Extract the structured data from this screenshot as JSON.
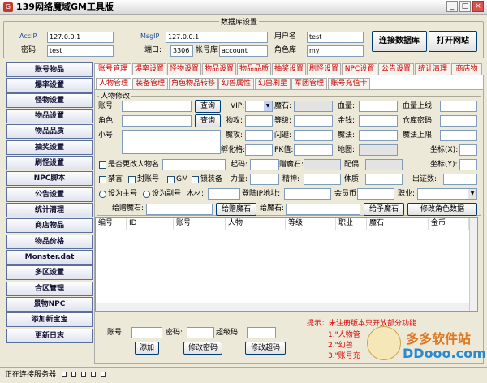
{
  "app": {
    "title": "139网络魔域GM工具版"
  },
  "db": {
    "group_title": "数据库设置",
    "acc_ip_label": "AccIP",
    "acc_ip": "127.0.0.1",
    "msg_ip_label": "MsgIP",
    "msg_ip": "127.0.0.1",
    "user_label": "用户名",
    "user": "test",
    "pass_label": "密码",
    "pass": "test",
    "port_label": "端口:",
    "port": "3306",
    "acc_db_label": "帐号库",
    "acc_db": "account",
    "role_db_label": "角色库",
    "role_db": "my",
    "connect_btn": "连接数据库",
    "open_site_btn": "打开网站"
  },
  "sidebar": {
    "items": [
      {
        "label": "账号物品"
      },
      {
        "label": "爆率设置"
      },
      {
        "label": "怪物设置"
      },
      {
        "label": "物品设置"
      },
      {
        "label": "物品品质"
      },
      {
        "label": "抽奖设置"
      },
      {
        "label": "刷怪设置"
      },
      {
        "label": "NPC脚本"
      },
      {
        "label": "公告设置"
      },
      {
        "label": "统计清理"
      },
      {
        "label": "商店物品"
      },
      {
        "label": "物品价格"
      },
      {
        "label": "Monster.dat"
      },
      {
        "label": "多区设置"
      },
      {
        "label": "合区管理"
      },
      {
        "label": "景物NPC"
      },
      {
        "label": "添加新宝宝"
      },
      {
        "label": "更新日志"
      }
    ]
  },
  "tabs": [
    {
      "label": "账号管理"
    },
    {
      "label": "爆率设置"
    },
    {
      "label": "怪物设置"
    },
    {
      "label": "物品设置"
    },
    {
      "label": "物品品质"
    },
    {
      "label": "抽奖设置"
    },
    {
      "label": "刷怪设置"
    },
    {
      "label": "NPC设置"
    },
    {
      "label": "公告设置"
    },
    {
      "label": "统计清理"
    },
    {
      "label": "商店物"
    }
  ],
  "subtabs": [
    {
      "label": "人物管理"
    },
    {
      "label": "装备管理"
    },
    {
      "label": "角色物品转移"
    },
    {
      "label": "幻兽属性"
    },
    {
      "label": "幻兽刷星"
    },
    {
      "label": "军团管理"
    },
    {
      "label": "账号充值卡"
    }
  ],
  "form": {
    "group_title": "人物修改",
    "account_label": "账号:",
    "query_btn": "查询",
    "vip_label": "VIP:",
    "magic_stone_label": "魔石:",
    "hp_label": "血量:",
    "hp_max_label": "血量上线:",
    "role_label": "角色:",
    "query_btn2": "查询",
    "attack_label": "物攻:",
    "level_label": "等级:",
    "gold_label": "金钱:",
    "warehouse_pwd_label": "仓库密码:",
    "nickname_label": "小号:",
    "magic_atk_label": "魔攻:",
    "dodge_label": "闪避:",
    "mana_label": "魔法:",
    "mana_max_label": "魔法上限:",
    "hatch_label": "孵化格:",
    "pk_label": "PK值:",
    "map_label": "地图:",
    "coord_x_label": "坐标(X):",
    "rename_label": "是否更改人物名",
    "start_code_label": "起码:",
    "gift_stone_label": "赠魔石:",
    "spouse_label": "配偶:",
    "coord_y_label": "坐标(Y):",
    "ban_label": "禁言",
    "ban_acc_label": "封账号",
    "gm_label": "GM",
    "equip_label": "锁装备",
    "strength_label": "力量:",
    "spirit_label": "精神:",
    "stamina_label": "体质:",
    "cert_label": "出证数:",
    "set_main_label": "设为主号",
    "set_sub_label": "设为副号",
    "wood_label": "木材:",
    "login_ip_label": "登陆IP地址:",
    "member_label": "会员币:",
    "job_label": "职业:",
    "give_stone_label": "给赠魔石:",
    "give_stone_btn": "给赠魔石",
    "give_magic_label": "给魔石:",
    "give_magic_btn": "给予魔石",
    "modify_btn": "修改角色数据"
  },
  "grid": {
    "columns": [
      "编号",
      "ID",
      "账号",
      "人物",
      "等级",
      "职业",
      "魔石",
      "金币"
    ]
  },
  "bottom": {
    "account_label": "账号:",
    "pass_label": "密码:",
    "super_code_label": "超级码:",
    "add_btn": "添加",
    "change_pass_btn": "修改密码",
    "change_code_btn": "修改超码",
    "tip_title": "提示：未注册版本只开放部分功能",
    "tips": [
      "1.\"人物管",
      "2.\"幻兽",
      "3.\"账号充"
    ],
    "watermark": "多多软件站",
    "watermark_url": "DDooo.com"
  },
  "status": {
    "text": "正在连接服务器"
  }
}
